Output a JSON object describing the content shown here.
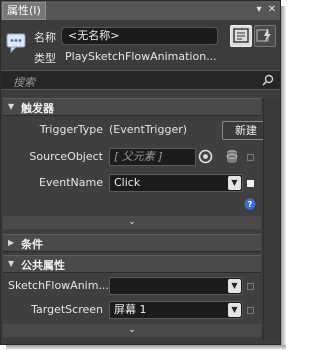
{
  "window": {
    "title": "属性(I)",
    "pin_glyph": "▾",
    "close_glyph": "✕"
  },
  "header": {
    "name_label": "名称",
    "name_value": "<无名称>",
    "type_label": "类型",
    "type_value": "PlaySketchFlowAnimation..."
  },
  "search": {
    "placeholder": "搜索"
  },
  "sections": {
    "triggers": {
      "title": "触发器",
      "trigger_type_label": "TriggerType",
      "trigger_type_value": "(EventTrigger)",
      "new_button": "新建",
      "source_object_label": "SourceObject",
      "source_object_value": "[ 父元素 ]",
      "event_name_label": "EventName",
      "event_name_value": "Click"
    },
    "conditions": {
      "title": "条件"
    },
    "common": {
      "title": "公共属性",
      "animation_label": "SketchFlowAnim...",
      "animation_value": "",
      "target_screen_label": "TargetScreen",
      "target_screen_value": "屏幕 1"
    }
  },
  "colors": {
    "panel": "#3d3d3d",
    "section_header": "#4a4a4a",
    "input_bg": "#1c1c1c",
    "help_blue": "#3b6fd6"
  }
}
